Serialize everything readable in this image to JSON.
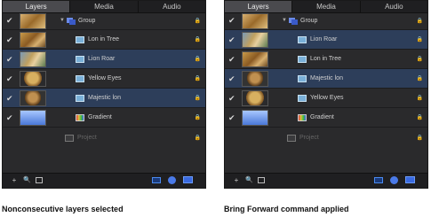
{
  "tabs": [
    "Layers",
    "Media",
    "Audio"
  ],
  "left_panel": {
    "group_label": "Group",
    "layers": [
      {
        "name": "Lon in Tree",
        "selected": false
      },
      {
        "name": "Lion Roar",
        "selected": true
      },
      {
        "name": "Yellow Eyes",
        "selected": false
      },
      {
        "name": "Majestic lon",
        "selected": true
      },
      {
        "name": "Gradient",
        "selected": false
      }
    ],
    "project_label": "Project"
  },
  "right_panel": {
    "group_label": "Group",
    "layers": [
      {
        "name": "Lion Roar",
        "selected": true
      },
      {
        "name": "Lon in Tree",
        "selected": false
      },
      {
        "name": "Majestic lon",
        "selected": true
      },
      {
        "name": "Yellow Eyes",
        "selected": false
      },
      {
        "name": "Gradient",
        "selected": false
      }
    ],
    "project_label": "Project"
  },
  "bottom_bar": {
    "add": "+",
    "search": "🔍"
  },
  "captions": {
    "left": "Nonconsecutive layers selected",
    "right": "Bring Forward command applied"
  },
  "colors": {
    "panel_bg": "#2a2a2c",
    "selection": "#2d3e5a",
    "accent_blue": "#3a6ae0"
  },
  "icons": {
    "checkbox": "checkmark-icon",
    "lock": "lock-icon",
    "group": "group-icon",
    "layer": "image-layer-icon",
    "gradient": "gradient-layer-icon"
  }
}
